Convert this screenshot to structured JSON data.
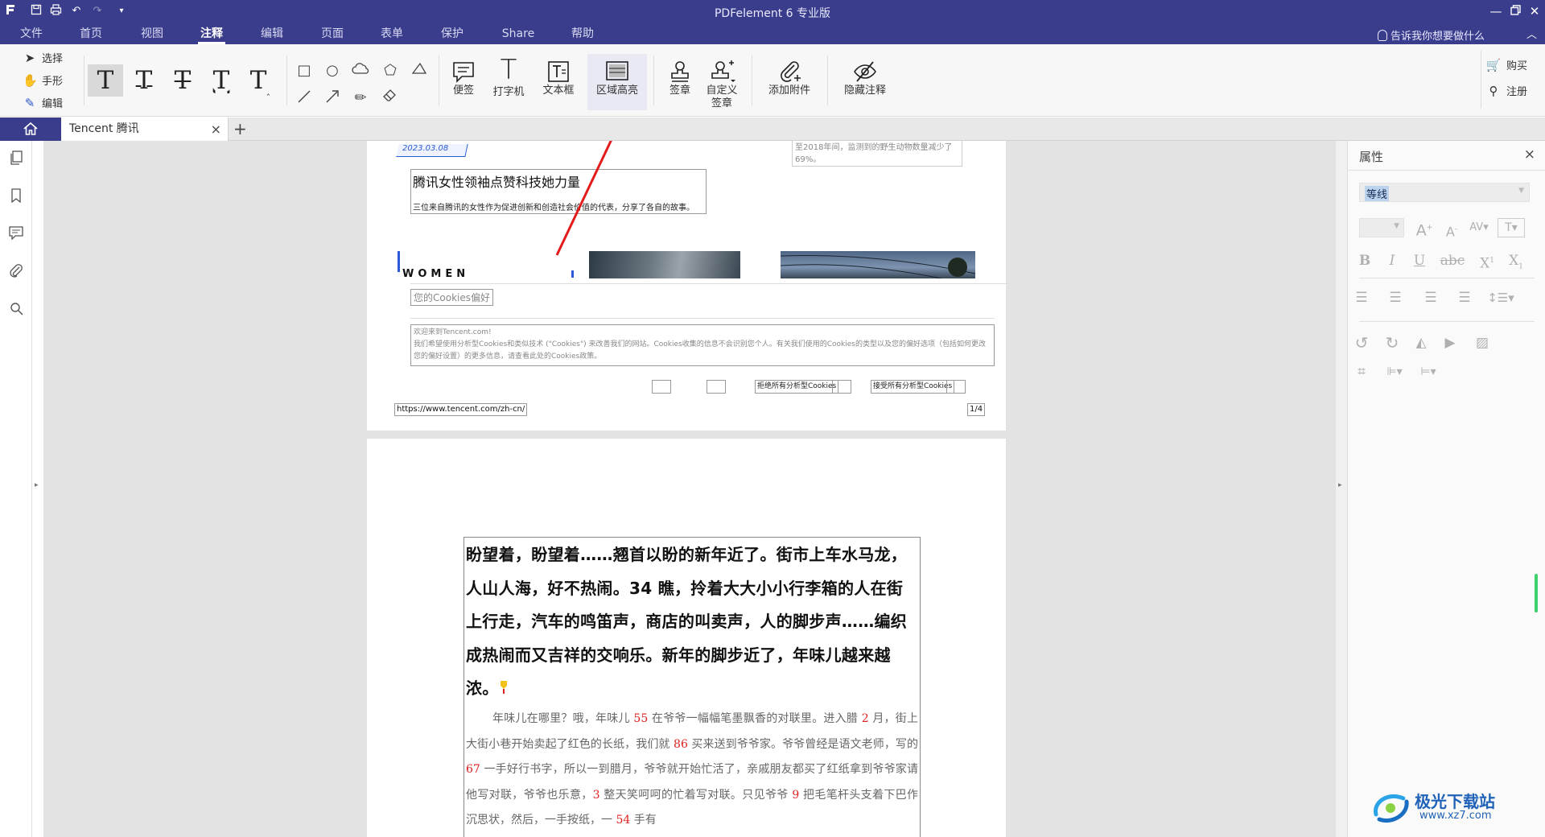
{
  "app": {
    "title": "PDFelement  6 专业版",
    "accent": "#3a3d8b"
  },
  "menubar": {
    "items": [
      {
        "label": "文件",
        "active": false
      },
      {
        "label": "首页",
        "active": false
      },
      {
        "label": "视图",
        "active": false
      },
      {
        "label": "注释",
        "active": true
      },
      {
        "label": "编辑",
        "active": false
      },
      {
        "label": "页面",
        "active": false
      },
      {
        "label": "表单",
        "active": false
      },
      {
        "label": "保护",
        "active": false
      },
      {
        "label": "Share",
        "active": false
      },
      {
        "label": "帮助",
        "active": false
      }
    ],
    "tell_me": "告诉我你想要做什么"
  },
  "ribbon": {
    "select_tools": [
      "选择",
      "手形",
      "编辑"
    ],
    "buttons": {
      "sticky_note": "便签",
      "typewriter": "打字机",
      "text_box": "文本框",
      "area_highlight": "区域高亮",
      "stamp": "签章",
      "custom_stamp": "自定义签章",
      "add_attachment": "添加附件",
      "hide_annotations": "隐藏注释"
    },
    "buy": "购买",
    "register": "注册"
  },
  "tabs": {
    "document": "Tencent 腾讯"
  },
  "page1": {
    "date_tag": "2023.03.08",
    "headline": "腾讯女性领袖点赞科技她力量",
    "subline": "三位来自腾讯的女性作为促进创新和创造社会价值的代表，分享了各自的故事。",
    "side_note": "至2018年间，监测到的野生动物数量减少了69%。",
    "women_label": "WOMEN",
    "cookie_title": "您的Cookies偏好",
    "cookie_welcome": "欢迎来到Tencent.com!",
    "cookie_body": "我们希望使用分析型Cookies和类似技术 (\"Cookies\") 来改善我们的网站。Cookies收集的信息不会识别您个人。有关我们使用的Cookies的类型以及您的偏好选项（包括如何更改您的偏好设置）的更多信息，请查看此处的Cookies政策。",
    "reject_button": "拒绝所有分析型Cookies",
    "accept_button": "接受所有分析型Cookies",
    "url": "https://www.tencent.com/zh-cn/",
    "page_number": "1/4"
  },
  "page2": {
    "heading": "盼望着，盼望着……翘首以盼的新年近了。街市上车水马龙，人山人海，好不热闹。34 瞧，拎着大大小小行李箱的人在街上行走，汽车的鸣笛声，商店的叫卖声，人的脚步声……编织成热闹而又吉祥的交响乐。新年的脚步近了，年味儿越来越浓。",
    "body_segments": [
      {
        "t": "年味儿在哪里？哦，年味儿 "
      },
      {
        "t": "55",
        "red": true
      },
      {
        "t": " 在爷爷一幅幅笔墨飘香的对联里。进入腊 "
      },
      {
        "t": "2",
        "red": true
      },
      {
        "t": " 月，街上大街小巷开始卖起了红色的长纸，我们就 "
      },
      {
        "t": "86",
        "red": true
      },
      {
        "t": " 买来送到爷爷家。爷爷曾经是语文老师，写的 "
      },
      {
        "t": "67",
        "red": true
      },
      {
        "t": " 一手好行书字，所以一到腊月，爷爷就开始忙活了，亲戚朋友都买了红纸拿到爷爷家请他写对联，爷爷也乐意，"
      },
      {
        "t": "3",
        "red": true
      },
      {
        "t": " 整天笑呵呵的忙着写对联。只见爷爷 "
      },
      {
        "t": "9",
        "red": true
      },
      {
        "t": " 把毛笔杆头支着下巴作沉思状，然后，一手按纸，一 "
      },
      {
        "t": "54",
        "red": true
      },
      {
        "t": " 手有"
      }
    ]
  },
  "properties": {
    "title": "属性",
    "font": "等线"
  },
  "watermark": {
    "text": "极光下载站",
    "url": "www.xz7.com"
  }
}
